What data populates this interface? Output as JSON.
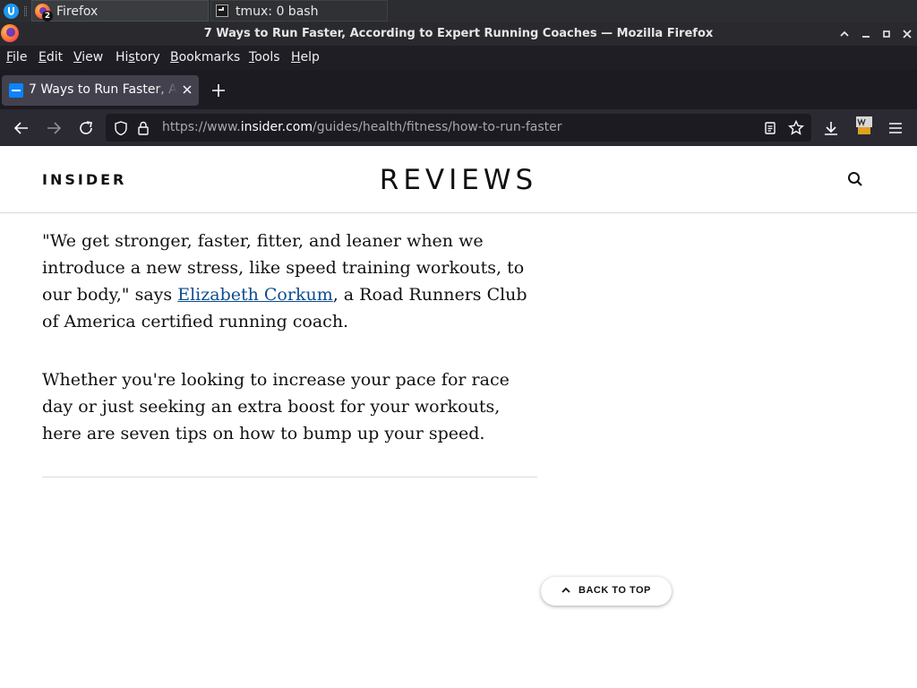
{
  "taskbar": {
    "tasks": [
      {
        "label": "Firefox",
        "badge": "2"
      },
      {
        "label": "tmux: 0 bash"
      }
    ]
  },
  "window": {
    "title": "7 Ways to Run Faster, According to Expert Running Coaches — Mozilla Firefox",
    "controls": [
      "chevron-up-icon",
      "minimize-icon",
      "maximize-icon",
      "close-icon"
    ]
  },
  "menubar": {
    "items": [
      {
        "label": "File",
        "mnemonic": "F",
        "rest": "ile"
      },
      {
        "label": "Edit",
        "mnemonic": "E",
        "rest": "dit"
      },
      {
        "label": "View",
        "mnemonic": "V",
        "rest": "iew"
      },
      {
        "label": "History",
        "pre": "Hi",
        "mnemonic": "s",
        "rest": "tory"
      },
      {
        "label": "Bookmarks",
        "mnemonic": "B",
        "rest": "ookmarks"
      },
      {
        "label": "Tools",
        "mnemonic": "T",
        "rest": "ools"
      },
      {
        "label": "Help",
        "mnemonic": "H",
        "rest": "elp"
      }
    ]
  },
  "tabs": [
    {
      "title": "7 Ways to Run Faster, According to Expert Running Coaches",
      "active": true
    }
  ],
  "urlbar": {
    "prefix": "https://www.",
    "host": "insider.com",
    "path": "/guides/health/fitness/how-to-run-faster"
  },
  "site": {
    "logo": "INSIDER",
    "section": "REVIEWS"
  },
  "article": {
    "p1_before": "\"We get stronger, faster, fitter, and leaner when we introduce a new stress, like speed training workouts, to our body,\" says ",
    "p1_link": "Elizabeth Corkum",
    "p1_after": ", a Road Runners Club of America certified running coach.",
    "p2": "Whether you're looking to increase your pace for race day or just seeking an extra boost for your workouts, here are seven tips on how to bump up your speed."
  },
  "back_to_top": "BACK TO TOP",
  "colors": {
    "accent": "#0a84ff",
    "link": "#0e4d8f",
    "toolbar_bg": "#2b2a33",
    "tab_active_bg": "#42414d"
  }
}
